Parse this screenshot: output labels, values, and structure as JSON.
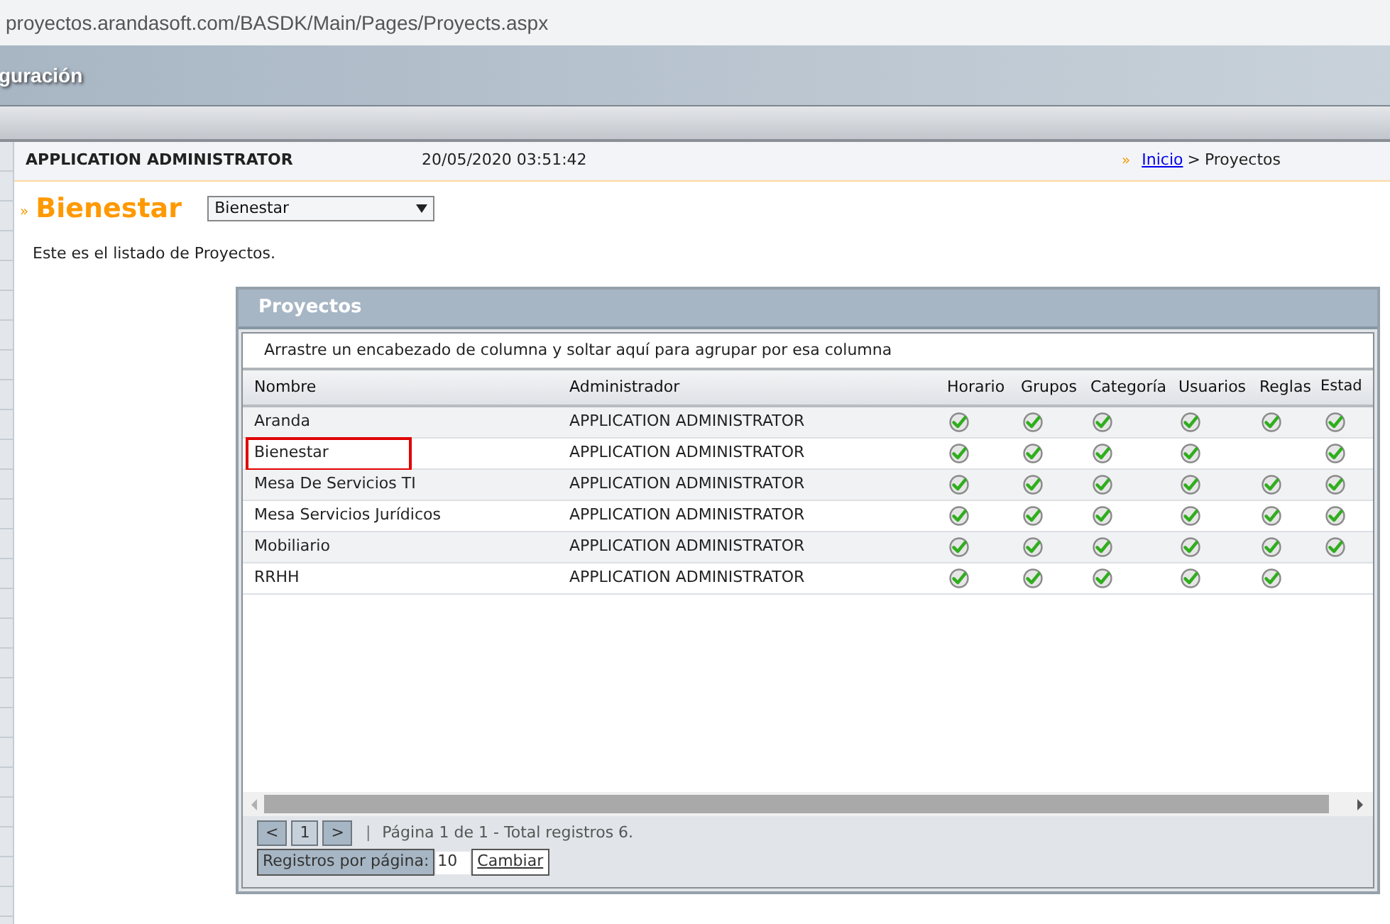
{
  "address_bar": {
    "url": "proyectos.arandasoft.com/BASDK/Main/Pages/Proyects.aspx"
  },
  "header": {
    "title": "guración"
  },
  "info_bar": {
    "user": "APPLICATION ADMINISTRATOR",
    "datetime": "20/05/2020 03:51:42",
    "breadcrumb": {
      "marker": "»",
      "link": "Inicio",
      "separator": ">",
      "current": "Proyectos"
    }
  },
  "page": {
    "marker": "»",
    "title": "Bienestar",
    "project_select": {
      "value": "Bienestar"
    },
    "description": "Este es el listado de Proyectos."
  },
  "grid": {
    "title": "Proyectos",
    "group_hint": "Arrastre un encabezado de columna y soltar aquí para agrupar por esa columna",
    "columns": [
      "Nombre",
      "Administrador",
      "Horario",
      "Grupos",
      "Categoría",
      "Usuarios",
      "Reglas",
      "Estad"
    ],
    "rows": [
      {
        "name": "Aranda",
        "admin": "APPLICATION ADMINISTRATOR",
        "checks": [
          true,
          true,
          true,
          true,
          true,
          true
        ],
        "highlighted": false
      },
      {
        "name": "Bienestar",
        "admin": "APPLICATION ADMINISTRATOR",
        "checks": [
          true,
          true,
          true,
          true,
          false,
          true
        ],
        "highlighted": true
      },
      {
        "name": "Mesa De Servicios TI",
        "admin": "APPLICATION ADMINISTRATOR",
        "checks": [
          true,
          true,
          true,
          true,
          true,
          true
        ],
        "highlighted": false
      },
      {
        "name": "Mesa Servicios Jurídicos",
        "admin": "APPLICATION ADMINISTRATOR",
        "checks": [
          true,
          true,
          true,
          true,
          true,
          true
        ],
        "highlighted": false
      },
      {
        "name": "Mobiliario",
        "admin": "APPLICATION ADMINISTRATOR",
        "checks": [
          true,
          true,
          true,
          true,
          true,
          true
        ],
        "highlighted": false
      },
      {
        "name": "RRHH",
        "admin": "APPLICATION ADMINISTRATOR",
        "checks": [
          true,
          true,
          true,
          true,
          true,
          false
        ],
        "highlighted": false
      }
    ],
    "pager": {
      "prev": "<",
      "pages": [
        {
          "label": "1",
          "selected": true
        }
      ],
      "next": ">",
      "separator": "|",
      "summary": "Página 1 de 1 - Total registros 6.",
      "page_size_label": "Registros por página:",
      "page_size": "10",
      "apply": "Cambiar"
    }
  }
}
